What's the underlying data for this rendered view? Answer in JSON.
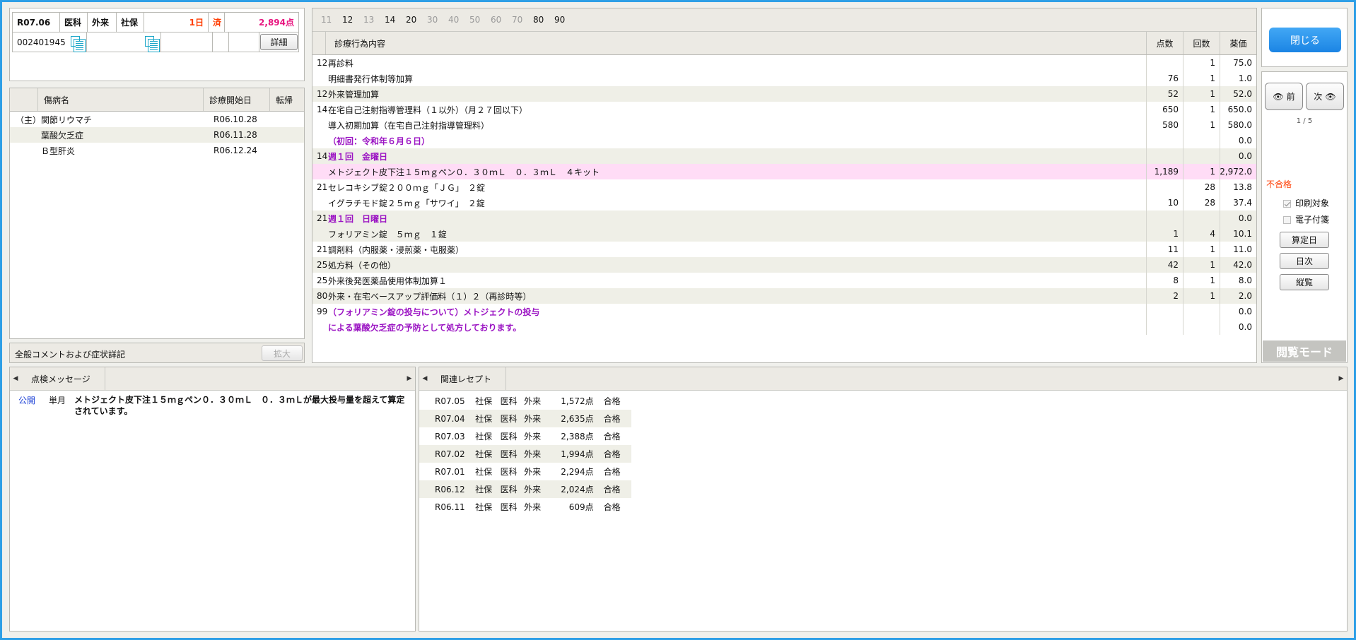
{
  "header": {
    "date": "R07.06",
    "kind": "医科",
    "setting": "外来",
    "insurance": "社保",
    "days": "1日",
    "status": "済",
    "points": "2,894点",
    "patient_id": "002401945",
    "detail_button": "詳細"
  },
  "diseases": {
    "columns": [
      "傷病名",
      "診療開始日",
      "転帰"
    ],
    "rows": [
      {
        "mark": "（主）",
        "name": "関節リウマチ",
        "date": "R06.10.28"
      },
      {
        "mark": "",
        "name": "葉酸欠乏症",
        "date": "R06.11.28"
      },
      {
        "mark": "",
        "name": "Ｂ型肝炎",
        "date": "R06.12.24"
      }
    ]
  },
  "comment": {
    "label": "全般コメントおよび症状詳記",
    "expand_button": "拡大"
  },
  "main": {
    "tabs": [
      {
        "label": "11",
        "on": false
      },
      {
        "label": "12",
        "on": true
      },
      {
        "label": "13",
        "on": false
      },
      {
        "label": "14",
        "on": true
      },
      {
        "label": "20",
        "on": true
      },
      {
        "label": "30",
        "on": false
      },
      {
        "label": "40",
        "on": false
      },
      {
        "label": "50",
        "on": false
      },
      {
        "label": "60",
        "on": false
      },
      {
        "label": "70",
        "on": false
      },
      {
        "label": "80",
        "on": true
      },
      {
        "label": "90",
        "on": true
      }
    ],
    "columns": {
      "content": "診療行為内容",
      "points": "点数",
      "count": "回数",
      "price": "薬価"
    },
    "rows": [
      {
        "code": "12",
        "name": "再診料",
        "points": "",
        "count": "1",
        "price": "75.0",
        "style": ""
      },
      {
        "code": "",
        "name": "明細書発行体制等加算",
        "points": "76",
        "count": "1",
        "price": "1.0",
        "style": ""
      },
      {
        "code": "12",
        "name": "外来管理加算",
        "points": "52",
        "count": "1",
        "price": "52.0",
        "style": "alt"
      },
      {
        "code": "14",
        "name": "在宅自己注射指導管理料（１以外）（月２７回以下）",
        "points": "650",
        "count": "1",
        "price": "650.0",
        "style": ""
      },
      {
        "code": "",
        "name": "導入初期加算（在宅自己注射指導管理料）",
        "points": "580",
        "count": "1",
        "price": "580.0",
        "style": ""
      },
      {
        "code": "",
        "name": "（初回：令和年６月６日）",
        "points": "",
        "count": "",
        "price": "0.0",
        "style": "purple"
      },
      {
        "code": "14",
        "name": "週１回　金曜日",
        "points": "",
        "count": "",
        "price": "0.0",
        "style": "alt purple"
      },
      {
        "code": "",
        "name": "メトジェクト皮下注１５ｍｇペン０．３０ｍＬ　０．３ｍＬ　４キット",
        "points": "1,189",
        "count": "1",
        "price": "2,972.0",
        "style": "hl"
      },
      {
        "code": "21",
        "name": "セレコキシブ錠２００ｍｇ「ＪＧ」　２錠",
        "points": "",
        "count": "28",
        "price": "13.8",
        "style": ""
      },
      {
        "code": "",
        "name": "イグラチモド錠２５ｍｇ「サワイ」　２錠",
        "points": "10",
        "count": "28",
        "price": "37.4",
        "style": ""
      },
      {
        "code": "21",
        "name": "週１回　日曜日",
        "points": "",
        "count": "",
        "price": "0.0",
        "style": "alt purple"
      },
      {
        "code": "",
        "name": "フォリアミン錠　５ｍｇ　１錠",
        "points": "1",
        "count": "4",
        "price": "10.1",
        "style": "alt"
      },
      {
        "code": "21",
        "name": "調剤料（内服薬・浸煎薬・屯服薬）",
        "points": "11",
        "count": "1",
        "price": "11.0",
        "style": ""
      },
      {
        "code": "25",
        "name": "処方料（その他）",
        "points": "42",
        "count": "1",
        "price": "42.0",
        "style": "alt"
      },
      {
        "code": "25",
        "name": "外来後発医薬品使用体制加算１",
        "points": "8",
        "count": "1",
        "price": "8.0",
        "style": ""
      },
      {
        "code": "80",
        "name": "外来・在宅ベースアップ評価料（１）２（再診時等）",
        "points": "2",
        "count": "1",
        "price": "2.0",
        "style": "alt"
      },
      {
        "code": "99",
        "name": "（フォリアミン錠の投与について）メトジェクトの投与",
        "points": "",
        "count": "",
        "price": "0.0",
        "style": "purple"
      },
      {
        "code": "",
        "name": "による葉酸欠乏症の予防として処方しております。",
        "points": "",
        "count": "",
        "price": "0.0",
        "style": "purple"
      }
    ]
  },
  "side": {
    "close_button": "閉じる",
    "prev_button": "前",
    "next_button": "次",
    "page": "1 / 5",
    "result": "不合格",
    "print_target": "印刷対象",
    "e_note": "電子付箋",
    "calc_day_button": "算定日",
    "daily_button": "日次",
    "list_button": "縦覧",
    "mode": "閲覧モード"
  },
  "check_messages": {
    "tab": "点検メッセージ",
    "items": [
      {
        "scope": "公開",
        "period": "単月",
        "text": "メトジェクト皮下注１５ｍｇペン０．３０ｍＬ　０．３ｍＬが最大投与量を超えて算定されています。"
      }
    ]
  },
  "related": {
    "tab": "関連レセプト",
    "rows": [
      {
        "date": "R07.05",
        "ins": "社保",
        "kind": "医科",
        "setting": "外来",
        "points": "1,572点",
        "result": "合格"
      },
      {
        "date": "R07.04",
        "ins": "社保",
        "kind": "医科",
        "setting": "外来",
        "points": "2,635点",
        "result": "合格"
      },
      {
        "date": "R07.03",
        "ins": "社保",
        "kind": "医科",
        "setting": "外来",
        "points": "2,388点",
        "result": "合格"
      },
      {
        "date": "R07.02",
        "ins": "社保",
        "kind": "医科",
        "setting": "外来",
        "points": "1,994点",
        "result": "合格"
      },
      {
        "date": "R07.01",
        "ins": "社保",
        "kind": "医科",
        "setting": "外来",
        "points": "2,294点",
        "result": "合格"
      },
      {
        "date": "R06.12",
        "ins": "社保",
        "kind": "医科",
        "setting": "外来",
        "points": "2,024点",
        "result": "合格"
      },
      {
        "date": "R06.11",
        "ins": "社保",
        "kind": "医科",
        "setting": "外来",
        "points": "609点",
        "result": "合格"
      }
    ]
  },
  "colors": {
    "accent": "#2e9fe6",
    "highlight": "#ffdcf6",
    "purple": "#9b14c3",
    "red": "#ff3c00",
    "pink": "#e8147f"
  }
}
